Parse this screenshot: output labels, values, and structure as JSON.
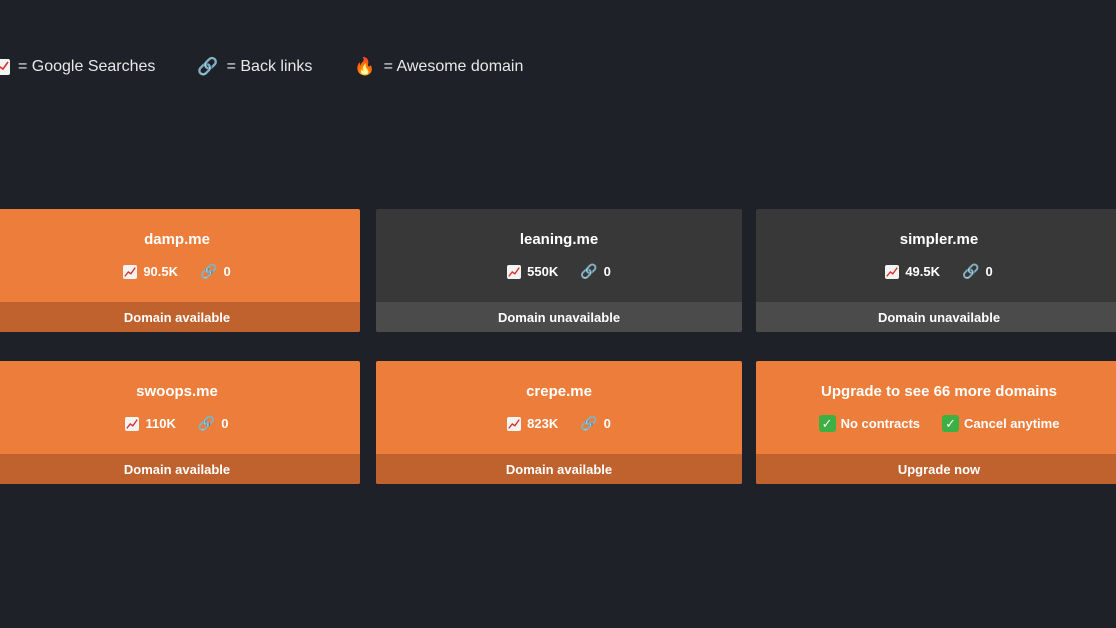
{
  "legend": {
    "searches_label": "= Google Searches",
    "backlinks_label": "= Back links",
    "awesome_label": "= Awesome domain"
  },
  "cards": [
    {
      "domain": "damp.me",
      "searches": "90.5K",
      "backlinks": "0",
      "status": "Domain available",
      "color": "#ed7d3a"
    },
    {
      "domain": "leaning.me",
      "searches": "550K",
      "backlinks": "0",
      "status": "Domain unavailable",
      "color": "#383838"
    },
    {
      "domain": "simpler.me",
      "searches": "49.5K",
      "backlinks": "0",
      "status": "Domain unavailable",
      "color": "#383838"
    },
    {
      "domain": "swoops.me",
      "searches": "110K",
      "backlinks": "0",
      "status": "Domain available",
      "color": "#ed7d3a"
    },
    {
      "domain": "crepe.me",
      "searches": "823K",
      "backlinks": "0",
      "status": "Domain available",
      "color": "#ed7d3a"
    }
  ],
  "upgrade": {
    "title": "Upgrade to see 66 more domains",
    "perk1": "No contracts",
    "perk2": "Cancel anytime",
    "button": "Upgrade now"
  }
}
